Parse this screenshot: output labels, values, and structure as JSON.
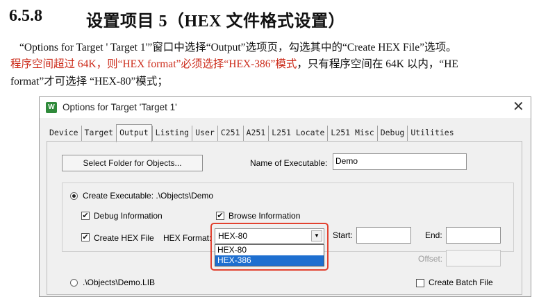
{
  "heading": {
    "number": "6.5.8",
    "title": "设置项目 5（HEX 文件格式设置）"
  },
  "paragraphs": {
    "p1": "“Options for Target ' Target 1'”窗口中选择“Output”选项页，勾选其中的“Create HEX File”选项。",
    "p2_red": "程序空间超过 64K，则“HEX format”必须选择“HEX-386”模式",
    "p2_rest": "，只有程序空间在 64K 以内，“HE",
    "p3": "format”才可选择 “HEX-80”模式；"
  },
  "dialog": {
    "title": "Options for Target 'Target 1'",
    "close": "✕",
    "app_icon": "keil-uvision-icon",
    "tabs": [
      "Device",
      "Target",
      "Output",
      "Listing",
      "User",
      "C251",
      "A251",
      "L251 Locate",
      "L251 Misc",
      "Debug",
      "Utilities"
    ],
    "active_tab": "Output",
    "select_folder_label": "Select Folder for Objects...",
    "name_exe_label": "Name of Executable:",
    "name_exe_value": "Demo",
    "create_exe_label": "Create Executable:  .\\Objects\\Demo",
    "debug_info_label": "Debug Information",
    "browse_info_label": "Browse Information",
    "create_hex_label": "Create HEX File",
    "hex_format_label": "HEX Format:",
    "hex_format_value": "HEX-80",
    "hex_options": [
      "HEX-80",
      "HEX-386"
    ],
    "highlighted_option": "HEX-386",
    "start_label": "Start:",
    "end_label": "End:",
    "offset_label": "Offset:",
    "lib_label": ".\\Objects\\Demo.LIB",
    "batch_label": "Create Batch File",
    "check_mark": "✔",
    "dropdown_arrow": "▼",
    "accent": "#1e6fd0",
    "highlight_box_color": "#e2412f"
  }
}
